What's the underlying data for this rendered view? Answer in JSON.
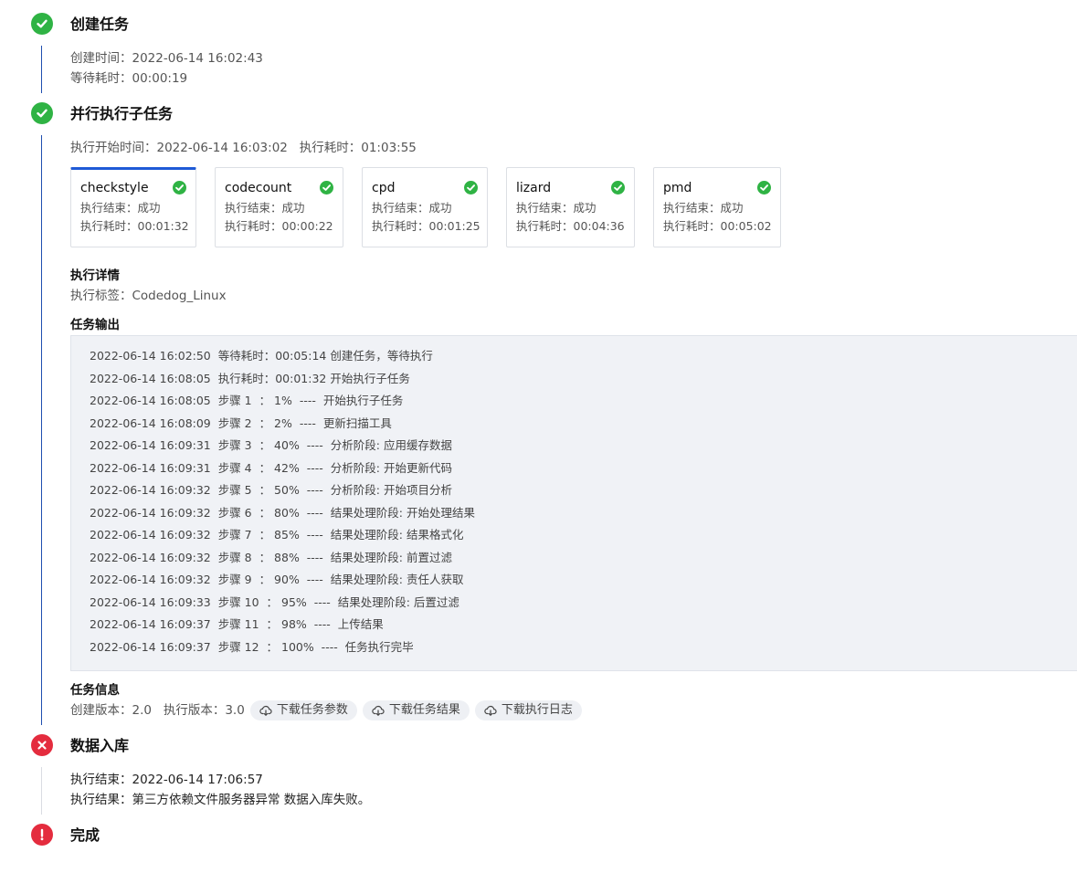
{
  "steps": {
    "create": {
      "title": "创建任务",
      "create_time": "创建时间：2022-06-14 16:02:43",
      "wait_time": "等待耗时：00:00:19"
    },
    "parallel": {
      "title": "并行执行子任务",
      "summary": "执行开始时间：2022-06-14 16:03:02   执行耗时：01:03:55",
      "subtasks": [
        {
          "name": "checkstyle",
          "result": "执行结束：成功",
          "duration": "执行耗时：00:01:32"
        },
        {
          "name": "codecount",
          "result": "执行结束：成功",
          "duration": "执行耗时：00:00:22"
        },
        {
          "name": "cpd",
          "result": "执行结束：成功",
          "duration": "执行耗时：00:01:25"
        },
        {
          "name": "lizard",
          "result": "执行结束：成功",
          "duration": "执行耗时：00:04:36"
        },
        {
          "name": "pmd",
          "result": "执行结束：成功",
          "duration": "执行耗时：00:05:02"
        }
      ],
      "details_label": "执行详情",
      "exec_tag": "执行标签：Codedog_Linux",
      "output_label": "任务输出",
      "log": [
        "2022-06-14 16:02:50  等待耗时：00:05:14 创建任务，等待执行",
        "2022-06-14 16:08:05  执行耗时：00:01:32 开始执行子任务",
        "2022-06-14 16:08:05  步骤 1  ： 1%  ----  开始执行子任务",
        "2022-06-14 16:08:09  步骤 2  ： 2%  ----  更新扫描工具",
        "2022-06-14 16:09:31  步骤 3  ： 40%  ----  分析阶段: 应用缓存数据",
        "2022-06-14 16:09:31  步骤 4  ： 42%  ----  分析阶段: 开始更新代码",
        "2022-06-14 16:09:32  步骤 5  ： 50%  ----  分析阶段: 开始项目分析",
        "2022-06-14 16:09:32  步骤 6  ： 80%  ----  结果处理阶段: 开始处理结果",
        "2022-06-14 16:09:32  步骤 7  ： 85%  ----  结果处理阶段: 结果格式化",
        "2022-06-14 16:09:32  步骤 8  ： 88%  ----  结果处理阶段: 前置过滤",
        "2022-06-14 16:09:32  步骤 9  ： 90%  ----  结果处理阶段: 责任人获取",
        "2022-06-14 16:09:33  步骤 10  ： 95%  ----  结果处理阶段: 后置过滤",
        "2022-06-14 16:09:37  步骤 11  ： 98%  ----  上传结果",
        "2022-06-14 16:09:37  步骤 12  ： 100%  ----  任务执行完毕"
      ],
      "info_label": "任务信息",
      "versions": "创建版本：2.0   执行版本：3.0",
      "buttons": {
        "params": "下载任务参数",
        "result": "下载任务结果",
        "log": "下载执行日志"
      }
    },
    "ingest": {
      "title": "数据入库",
      "end_time": "执行结束：2022-06-14 17:06:57",
      "result": "执行结果：第三方依赖文件服务器异常 数据入库失败。"
    },
    "done": {
      "title": "完成"
    }
  },
  "colors": {
    "success": "#2fb344",
    "error": "#e42c3e",
    "accent": "#1f5ad6",
    "line_active": "#1f4fb0",
    "line_inactive": "#d9dce2"
  },
  "icons": {
    "success": "check-circle-icon",
    "error": "x-circle-icon",
    "warning": "exclamation-circle-icon",
    "download": "cloud-download-icon"
  }
}
